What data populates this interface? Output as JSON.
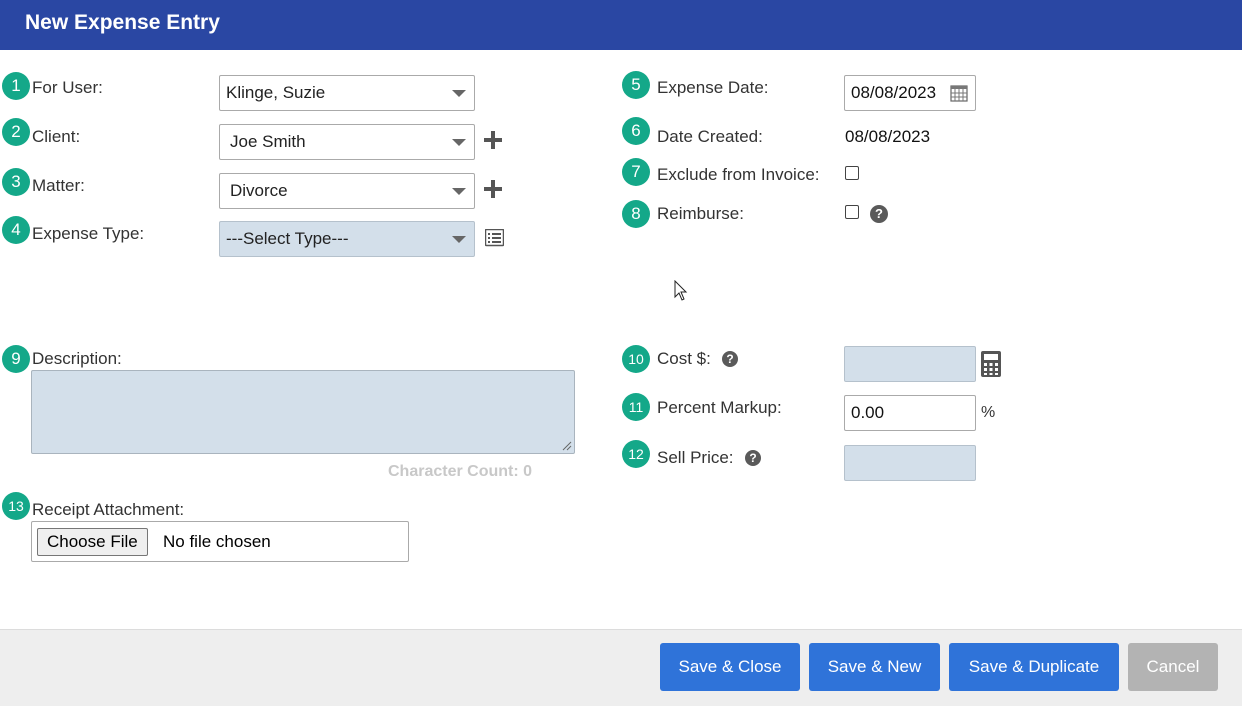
{
  "header": {
    "title": "New Expense Entry"
  },
  "fields": {
    "for_user": {
      "num": "1",
      "label": "For User:",
      "value": "Klinge, Suzie"
    },
    "client": {
      "num": "2",
      "label": "Client:",
      "value": "Joe Smith"
    },
    "matter": {
      "num": "3",
      "label": "Matter:",
      "value": "Divorce"
    },
    "expense_type": {
      "num": "4",
      "label": "Expense Type:",
      "value": "---Select Type---"
    },
    "expense_date": {
      "num": "5",
      "label": "Expense Date:",
      "value": "08/08/2023"
    },
    "date_created": {
      "num": "6",
      "label": "Date Created:",
      "value": "08/08/2023"
    },
    "exclude_invoice": {
      "num": "7",
      "label": "Exclude from Invoice:",
      "checked": false
    },
    "reimburse": {
      "num": "8",
      "label": "Reimburse:",
      "checked": false
    },
    "description": {
      "num": "9",
      "label": "Description:",
      "value": "",
      "char_count": "Character Count: 0"
    },
    "cost": {
      "num": "10",
      "label": "Cost $:",
      "value": ""
    },
    "percent_markup": {
      "num": "11",
      "label": "Percent Markup:",
      "value": "0.00",
      "suffix": "%"
    },
    "sell_price": {
      "num": "12",
      "label": "Sell Price:",
      "value": ""
    },
    "receipt": {
      "num": "13",
      "label": "Receipt Attachment:",
      "button": "Choose File",
      "status": "No file chosen"
    }
  },
  "icons": {
    "help": "?",
    "add": "plus-icon",
    "list": "list-icon",
    "calendar": "calendar-icon",
    "calculator": "calculator-icon"
  },
  "footer": {
    "save_close": "Save & Close",
    "save_new": "Save & New",
    "save_duplicate": "Save & Duplicate",
    "cancel": "Cancel"
  },
  "colors": {
    "header": "#2a47a3",
    "badge": "#14a889",
    "primary_button": "#2f73d9",
    "cancel_button": "#b3b3b3",
    "field_blue": "#d3dfea"
  }
}
